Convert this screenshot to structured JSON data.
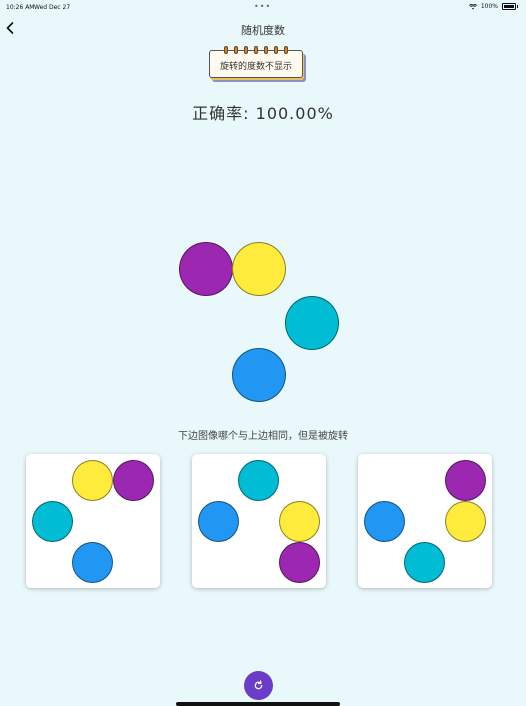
{
  "status_bar": {
    "time": "10:26 AM",
    "date": "Wed Dec 27",
    "dots": "•••",
    "battery_text": "100%"
  },
  "nav": {
    "title": "随机度数",
    "back_icon": "chevron-left-icon"
  },
  "badge": {
    "text": "旋转的度数不显示"
  },
  "accuracy": {
    "text": "正确率: 100.00%"
  },
  "question": {
    "text": "下边图像哪个与上边相同，但是被旋转"
  },
  "colors": {
    "purple": "#9c27b0",
    "yellow": "#ffeb3b",
    "teal": "#00bcd4",
    "blue": "#2196f3",
    "refresh": "#6a3cc9",
    "background": "#e9f8fb"
  },
  "target_circles": [
    "purple",
    "yellow",
    "teal",
    "blue"
  ],
  "options": [
    {
      "circles": [
        "yellow",
        "purple",
        "teal",
        "blue"
      ]
    },
    {
      "circles": [
        "teal",
        "blue",
        "yellow",
        "purple"
      ]
    },
    {
      "circles": [
        "purple",
        "blue",
        "yellow",
        "teal"
      ]
    }
  ],
  "refresh_icon": "refresh-icon"
}
